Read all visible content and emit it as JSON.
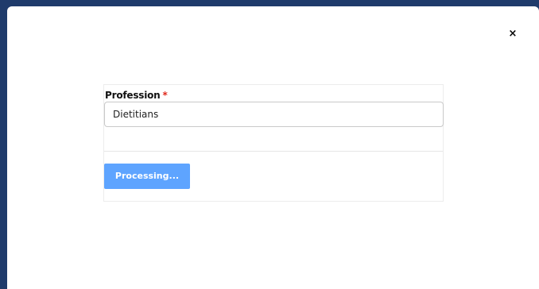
{
  "modal": {
    "close_label": "×"
  },
  "form": {
    "profession_label": "Profession",
    "required_marker": "*",
    "profession_value": "Dietitians",
    "submit_label": "Processing..."
  },
  "colors": {
    "accent_button": "#5ea4ff",
    "required": "#e0291c",
    "backdrop": "#1f3b6b"
  },
  "icons": {
    "close": "close-icon"
  }
}
